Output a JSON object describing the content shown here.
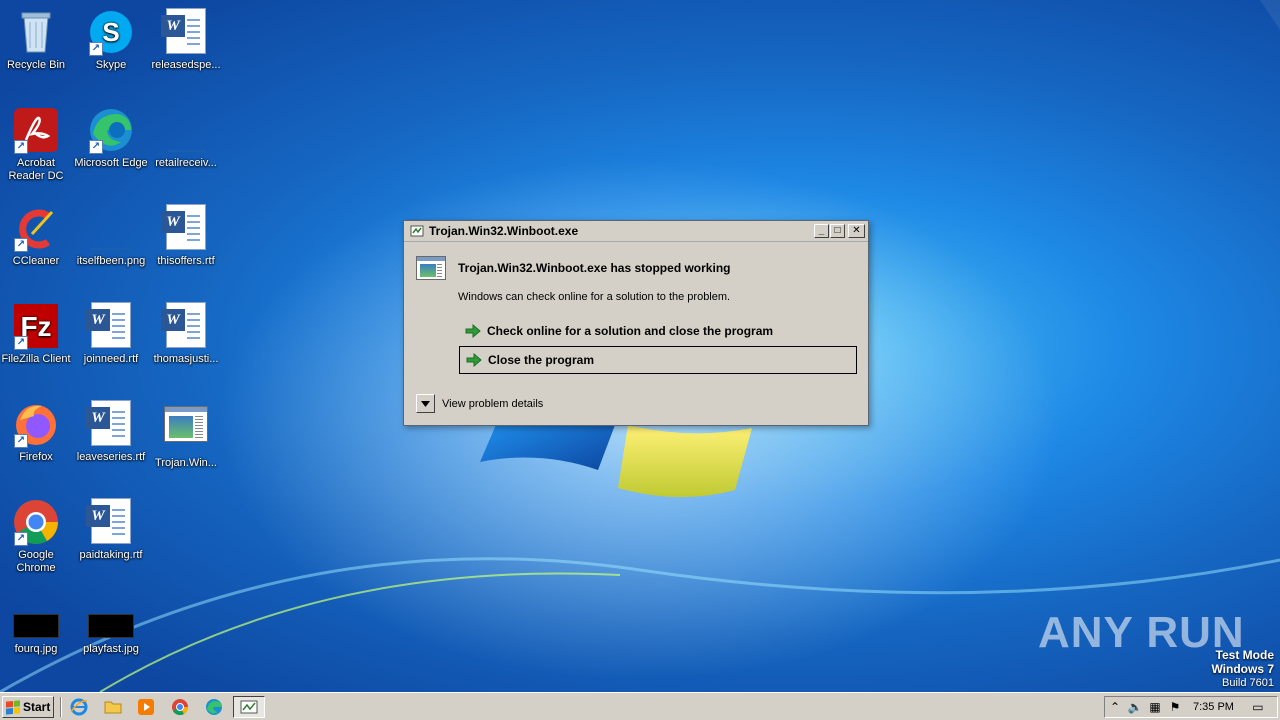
{
  "desktop": {
    "icons": [
      {
        "label": "Recycle Bin",
        "icon": "recycle-bin-icon"
      },
      {
        "label": "Skype",
        "icon": "skype-icon"
      },
      {
        "label": "releasedspe...",
        "icon": "word-document-icon"
      },
      {
        "label": "Acrobat Reader DC",
        "icon": "acrobat-icon"
      },
      {
        "label": "Microsoft Edge",
        "icon": "edge-icon"
      },
      {
        "label": "retailreceiv...",
        "icon": "blank-file-icon"
      },
      {
        "label": "CCleaner",
        "icon": "ccleaner-icon"
      },
      {
        "label": "itselfbeen.png",
        "icon": "image-file-icon"
      },
      {
        "label": "thisoffers.rtf",
        "icon": "word-document-icon"
      },
      {
        "label": "FileZilla Client",
        "icon": "filezilla-icon"
      },
      {
        "label": "joinneed.rtf",
        "icon": "word-document-icon"
      },
      {
        "label": "thomasjusti...",
        "icon": "word-document-icon"
      },
      {
        "label": "Firefox",
        "icon": "firefox-icon"
      },
      {
        "label": "leaveseries.rtf",
        "icon": "word-document-icon"
      },
      {
        "label": "Trojan.Win...",
        "icon": "program-icon"
      },
      {
        "label": "Google Chrome",
        "icon": "chrome-icon"
      },
      {
        "label": "paidtaking.rtf",
        "icon": "word-document-icon"
      },
      {
        "label": "fourq.jpg",
        "icon": "black-image-icon"
      },
      {
        "label": "playfast.jpg",
        "icon": "black-image-icon"
      }
    ]
  },
  "dialog": {
    "title": "Trojan.Win32.Winboot.exe",
    "heading": "Trojan.Win32.Winboot.exe has stopped working",
    "subtext": "Windows can check online for a solution to the problem.",
    "option_check_online": "Check online for a solution and close the program",
    "option_close": "Close the program",
    "details_label": "View problem details",
    "minimize": "_",
    "maximize": "□",
    "close": "✕"
  },
  "watermark": {
    "text": "ANY RUN"
  },
  "system_info": {
    "line1": "Test Mode",
    "line2": "Windows 7",
    "line3": "Build 7601"
  },
  "taskbar": {
    "start_label": "Start",
    "clock": "7:35 PM",
    "pinned": [
      "internet-explorer-icon",
      "folder-icon",
      "media-player-icon",
      "chrome-icon",
      "edge-icon"
    ],
    "tray_icons": [
      "show-hidden-icon",
      "volume-icon",
      "network-icon",
      "action-center-flag-icon",
      "show-desktop-icon"
    ]
  },
  "colors": {
    "dialog_bg": "#d4d0c8",
    "desktop_blue": "#1e88e5"
  }
}
